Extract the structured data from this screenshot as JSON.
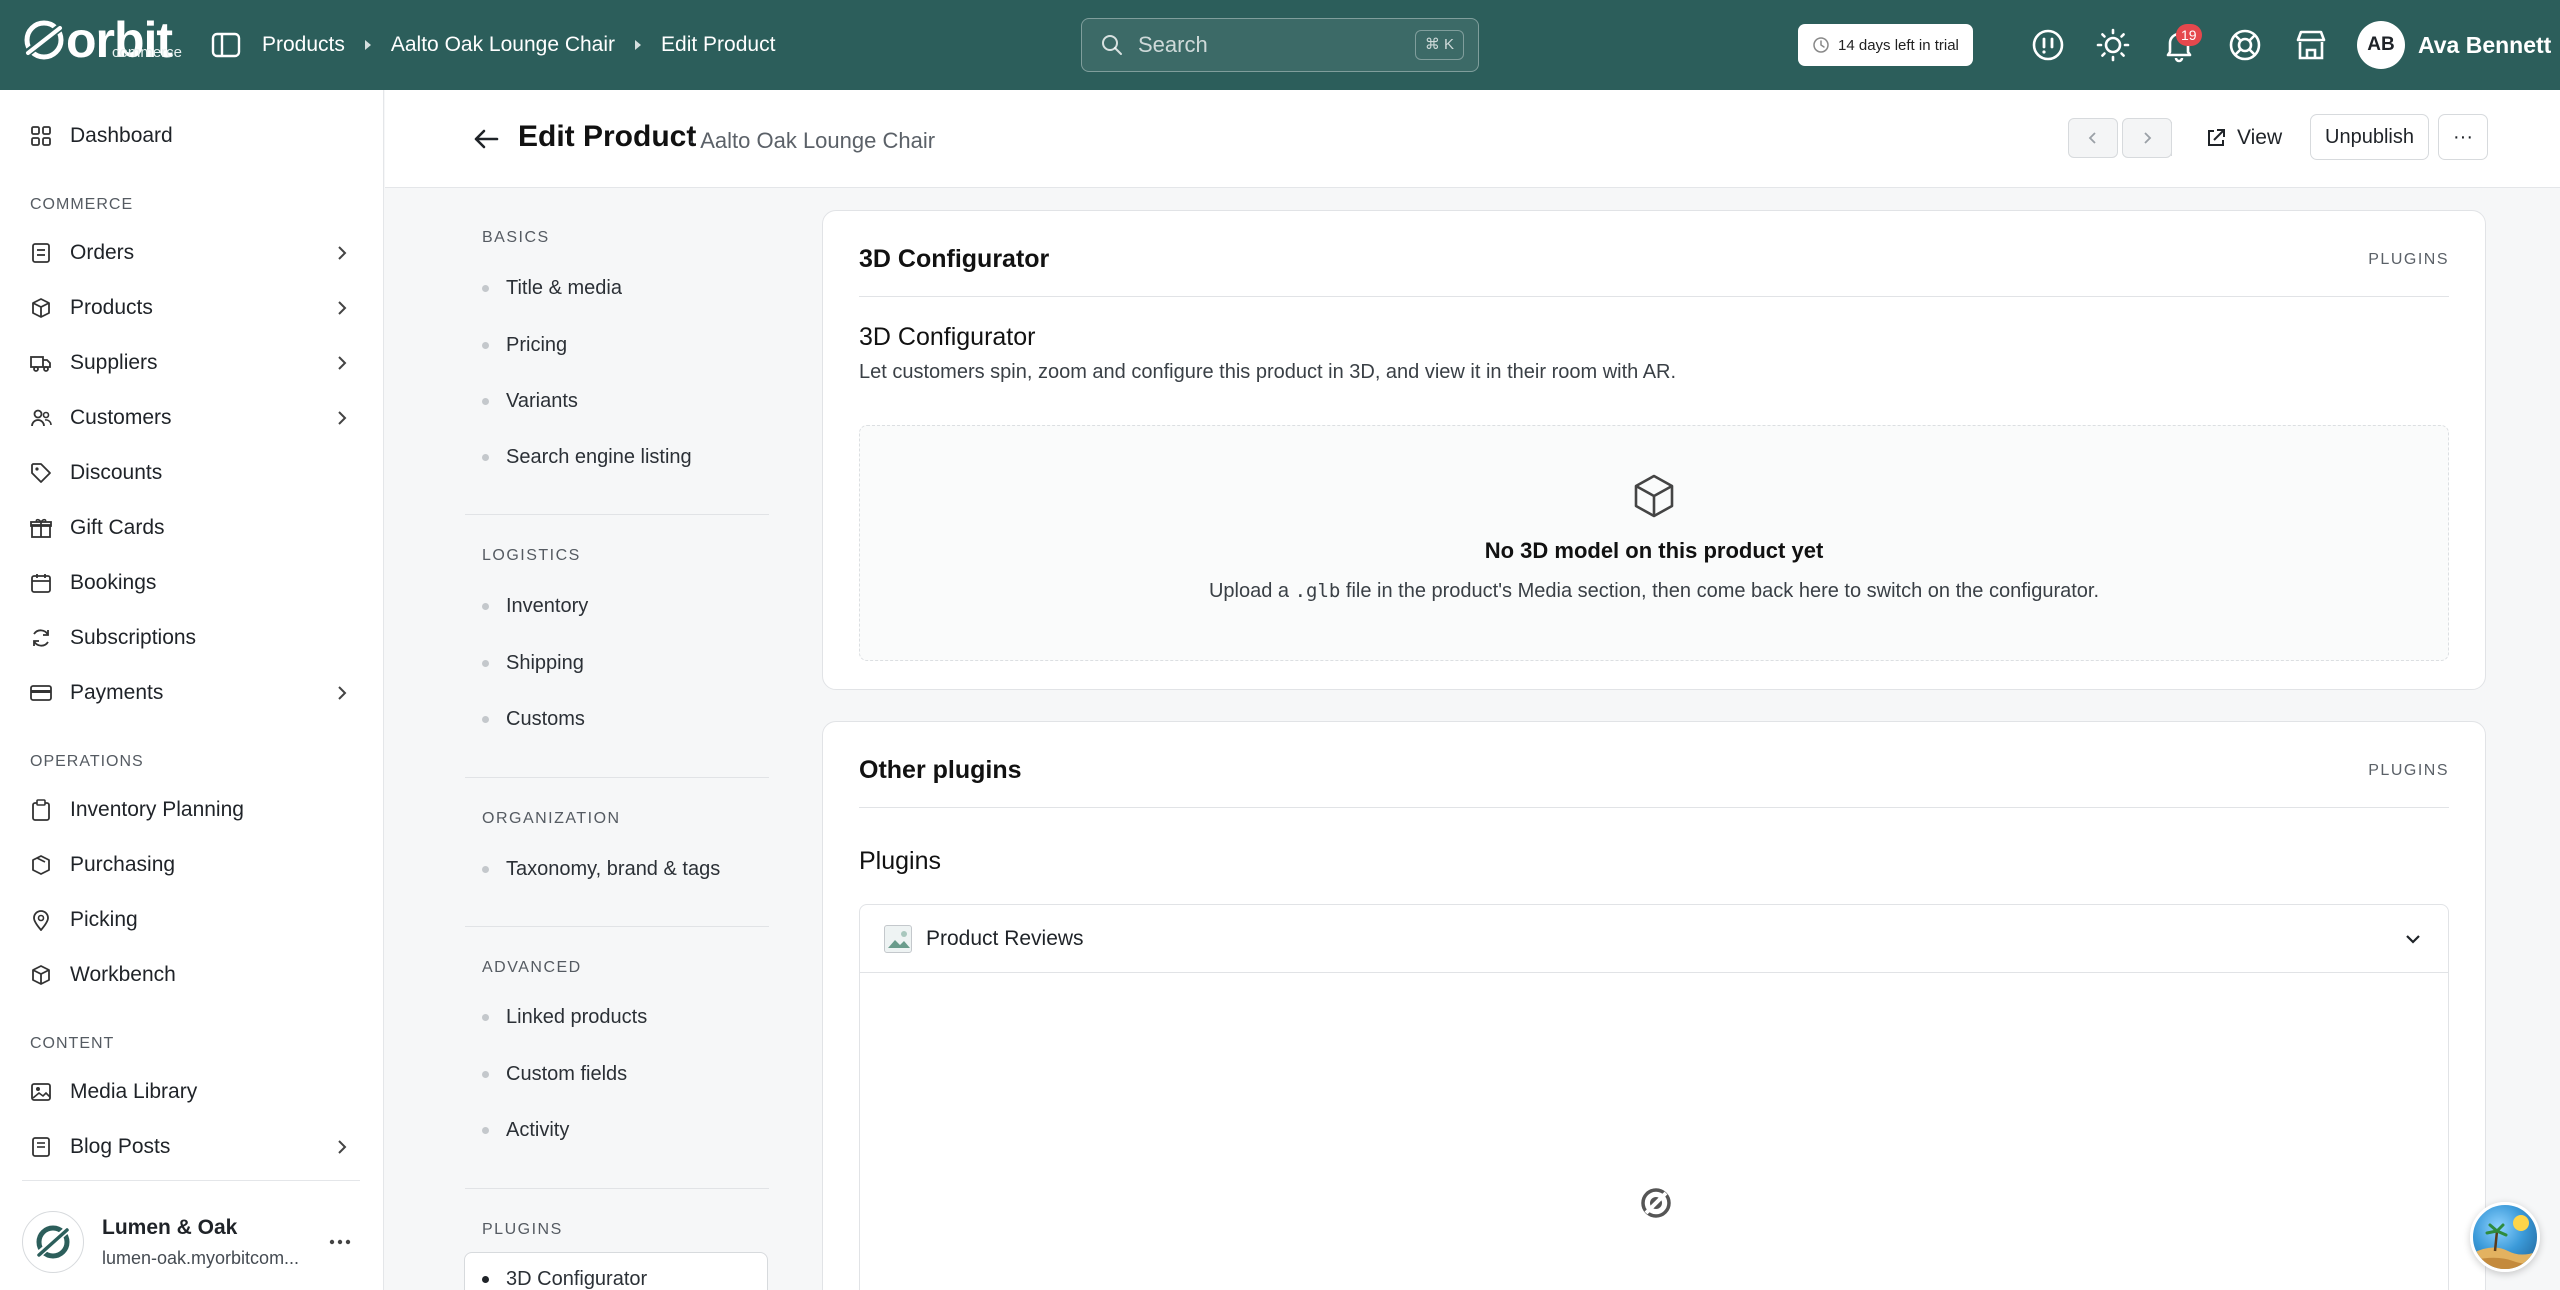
{
  "topbar": {
    "logo": "orbit",
    "logo_sub": "commerce",
    "breadcrumbs": [
      "Products",
      "Aalto Oak Lounge Chair",
      "Edit Product"
    ],
    "search_placeholder": "Search",
    "search_shortcut": "⌘ K",
    "trial_text": "14 days left in trial",
    "notification_count": "19",
    "user_initials": "AB",
    "user_name": "Ava Bennett",
    "icons": [
      "sidebar-toggle-icon",
      "help-icon",
      "theme-sun-icon",
      "bell-icon",
      "support-icon",
      "store-icon"
    ]
  },
  "sidebar": {
    "dashboard": "Dashboard",
    "sections": {
      "commerce": "COMMERCE",
      "operations": "OPERATIONS",
      "content": "CONTENT"
    },
    "commerce_items": [
      {
        "label": "Orders",
        "has_children": true
      },
      {
        "label": "Products",
        "has_children": true
      },
      {
        "label": "Suppliers",
        "has_children": true
      },
      {
        "label": "Customers",
        "has_children": true
      },
      {
        "label": "Discounts",
        "has_children": false
      },
      {
        "label": "Gift Cards",
        "has_children": false
      },
      {
        "label": "Bookings",
        "has_children": false
      },
      {
        "label": "Subscriptions",
        "has_children": false
      },
      {
        "label": "Payments",
        "has_children": true
      }
    ],
    "operations_items": [
      {
        "label": "Inventory Planning"
      },
      {
        "label": "Purchasing"
      },
      {
        "label": "Picking"
      },
      {
        "label": "Workbench"
      }
    ],
    "content_items": [
      {
        "label": "Media Library",
        "has_children": false
      },
      {
        "label": "Blog Posts",
        "has_children": true
      }
    ],
    "store": {
      "name": "Lumen & Oak",
      "url": "lumen-oak.myorbitcom..."
    }
  },
  "header": {
    "title": "Edit Product",
    "subtitle": "· Aalto Oak Lounge Chair",
    "view_label": "View",
    "unpublish_label": "Unpublish",
    "more_label": "···"
  },
  "section_nav": {
    "groups": [
      {
        "heading": "BASICS",
        "items": [
          "Title & media",
          "Pricing",
          "Variants",
          "Search engine listing"
        ]
      },
      {
        "heading": "LOGISTICS",
        "items": [
          "Inventory",
          "Shipping",
          "Customs"
        ]
      },
      {
        "heading": "ORGANIZATION",
        "items": [
          "Taxonomy, brand & tags"
        ]
      },
      {
        "heading": "ADVANCED",
        "items": [
          "Linked products",
          "Custom fields",
          "Activity"
        ]
      },
      {
        "heading": "PLUGINS",
        "items": [
          "3D Configurator"
        ]
      }
    ],
    "active_item": "3D Configurator"
  },
  "configurator_card": {
    "title": "3D Configurator",
    "tag": "PLUGINS",
    "section_title": "3D Configurator",
    "section_desc": "Let customers spin, zoom and configure this product in 3D, and view it in their room with AR.",
    "empty_title": "No 3D model on this product yet",
    "empty_desc_before": "Upload a ",
    "empty_desc_code": ".glb",
    "empty_desc_after": " file in the product's Media section, then come back here to switch on the configurator."
  },
  "plugins_card": {
    "title": "Other plugins",
    "tag": "PLUGINS",
    "section_title": "Plugins",
    "accordion_label": "Product Reviews"
  },
  "colors": {
    "topbar": "#2c5e5b",
    "badge": "#e5484d",
    "page_bg": "#f6f7f8"
  }
}
